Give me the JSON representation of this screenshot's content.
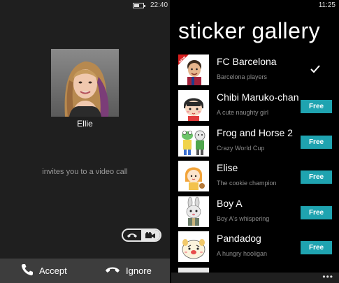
{
  "call_screen": {
    "status": {
      "time": "22:40",
      "battery_level": 0.55
    },
    "caller_name": "Ellie",
    "invite_text": "invites you to a video call",
    "icons": {
      "mode_toggle": [
        "phone-icon",
        "video-camera-icon"
      ]
    },
    "actions": {
      "accept_label": "Accept",
      "ignore_label": "Ignore"
    }
  },
  "gallery": {
    "status": {
      "time": "11:25"
    },
    "title": "sticker gallery",
    "items": [
      {
        "name": "FC Barcelona",
        "description": "Barcelona players",
        "state": "installed",
        "badge": "NEW"
      },
      {
        "name": "Chibi Maruko-chan",
        "description": "A cute naughty girl",
        "action": "Free"
      },
      {
        "name": "Frog and Horse 2",
        "description": "Crazy World Cup",
        "action": "Free"
      },
      {
        "name": "Elise",
        "description": "The cookie champion",
        "action": "Free"
      },
      {
        "name": "Boy A",
        "description": "Boy A's whispering",
        "action": "Free"
      },
      {
        "name": "Pandadog",
        "description": "A hungry hooligan",
        "action": "Free"
      }
    ],
    "app_bar": {
      "more_label": "•••"
    },
    "colors": {
      "accent": "#1fa3b0"
    }
  }
}
